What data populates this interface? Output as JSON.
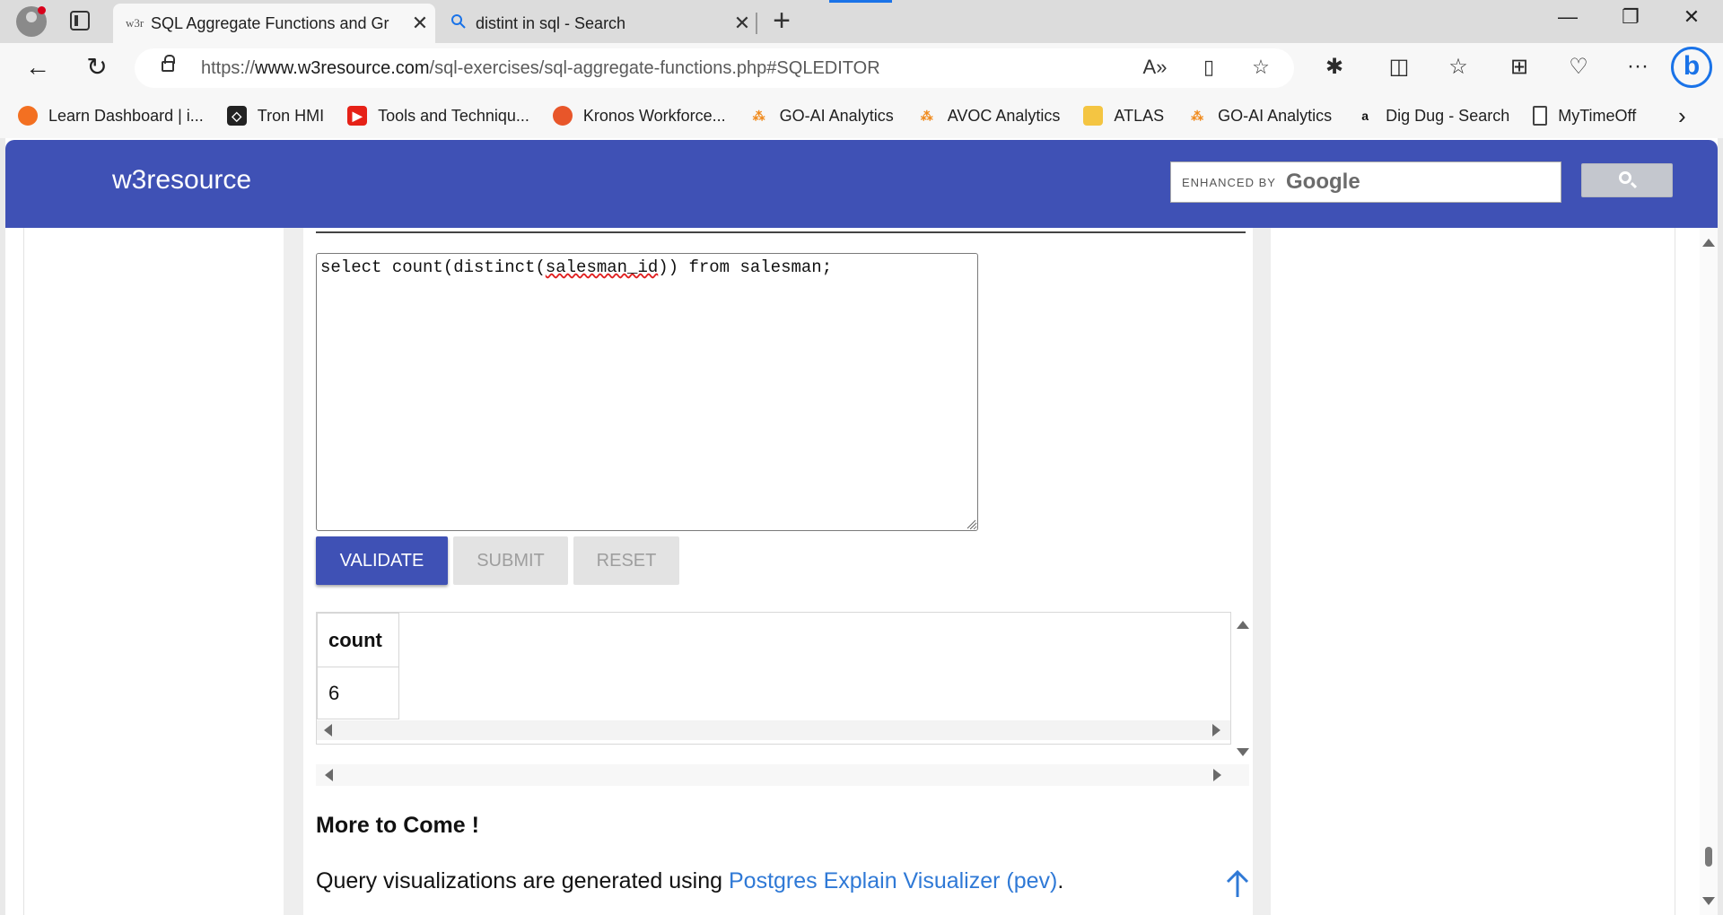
{
  "browser": {
    "tabs": [
      {
        "favicon": "w3r",
        "title": "SQL Aggregate Functions and Gr",
        "active": true
      },
      {
        "favicon": "search-icon",
        "title": "distint in sql - Search",
        "active": false
      }
    ],
    "address": {
      "protocol": "https://",
      "host": "www.w3resource.com",
      "path": "/sql-exercises/sql-aggregate-functions.php#SQLEDITOR"
    },
    "favorites": [
      {
        "label": "Learn Dashboard | i...",
        "icon": "orange-circle-icon",
        "color": "#f37021"
      },
      {
        "label": "Tron HMI",
        "icon": "unity-icon",
        "color": "#222222"
      },
      {
        "label": "Tools and Techniqu...",
        "icon": "youtube-icon",
        "color": "#e62117"
      },
      {
        "label": "Kronos Workforce...",
        "icon": "kronos-icon",
        "color": "#e8562a"
      },
      {
        "label": "GO-AI Analytics",
        "icon": "analytics-icon",
        "color": "#f08a1c"
      },
      {
        "label": "AVOC Analytics",
        "icon": "analytics-icon",
        "color": "#f08a1c"
      },
      {
        "label": "ATLAS",
        "icon": "folder-icon",
        "color": "#f4c542"
      },
      {
        "label": "GO-AI Analytics",
        "icon": "analytics-icon",
        "color": "#f08a1c"
      },
      {
        "label": "Dig Dug - Search",
        "icon": "amazon-icon",
        "color": "#111111"
      },
      {
        "label": "MyTimeOff",
        "icon": "page-icon",
        "color": "#555555"
      }
    ]
  },
  "site": {
    "brand": "w3resource",
    "search": {
      "enhanced_by": "ENHANCED BY",
      "google": "Google"
    },
    "accent": "#3f51b5"
  },
  "editor": {
    "query_before": "select count(distinct(",
    "query_squiggle": "salesman_id",
    "query_after": ")) from salesman;"
  },
  "buttons": {
    "validate": "VALIDATE",
    "submit": "SUBMIT",
    "reset": "RESET"
  },
  "result": {
    "columns": [
      "count"
    ],
    "rows": [
      [
        "6"
      ]
    ]
  },
  "footer": {
    "heading": "More to Come !",
    "text": "Query visualizations are generated using ",
    "link": "Postgres Explain Visualizer (pev)",
    "trailing": "."
  }
}
